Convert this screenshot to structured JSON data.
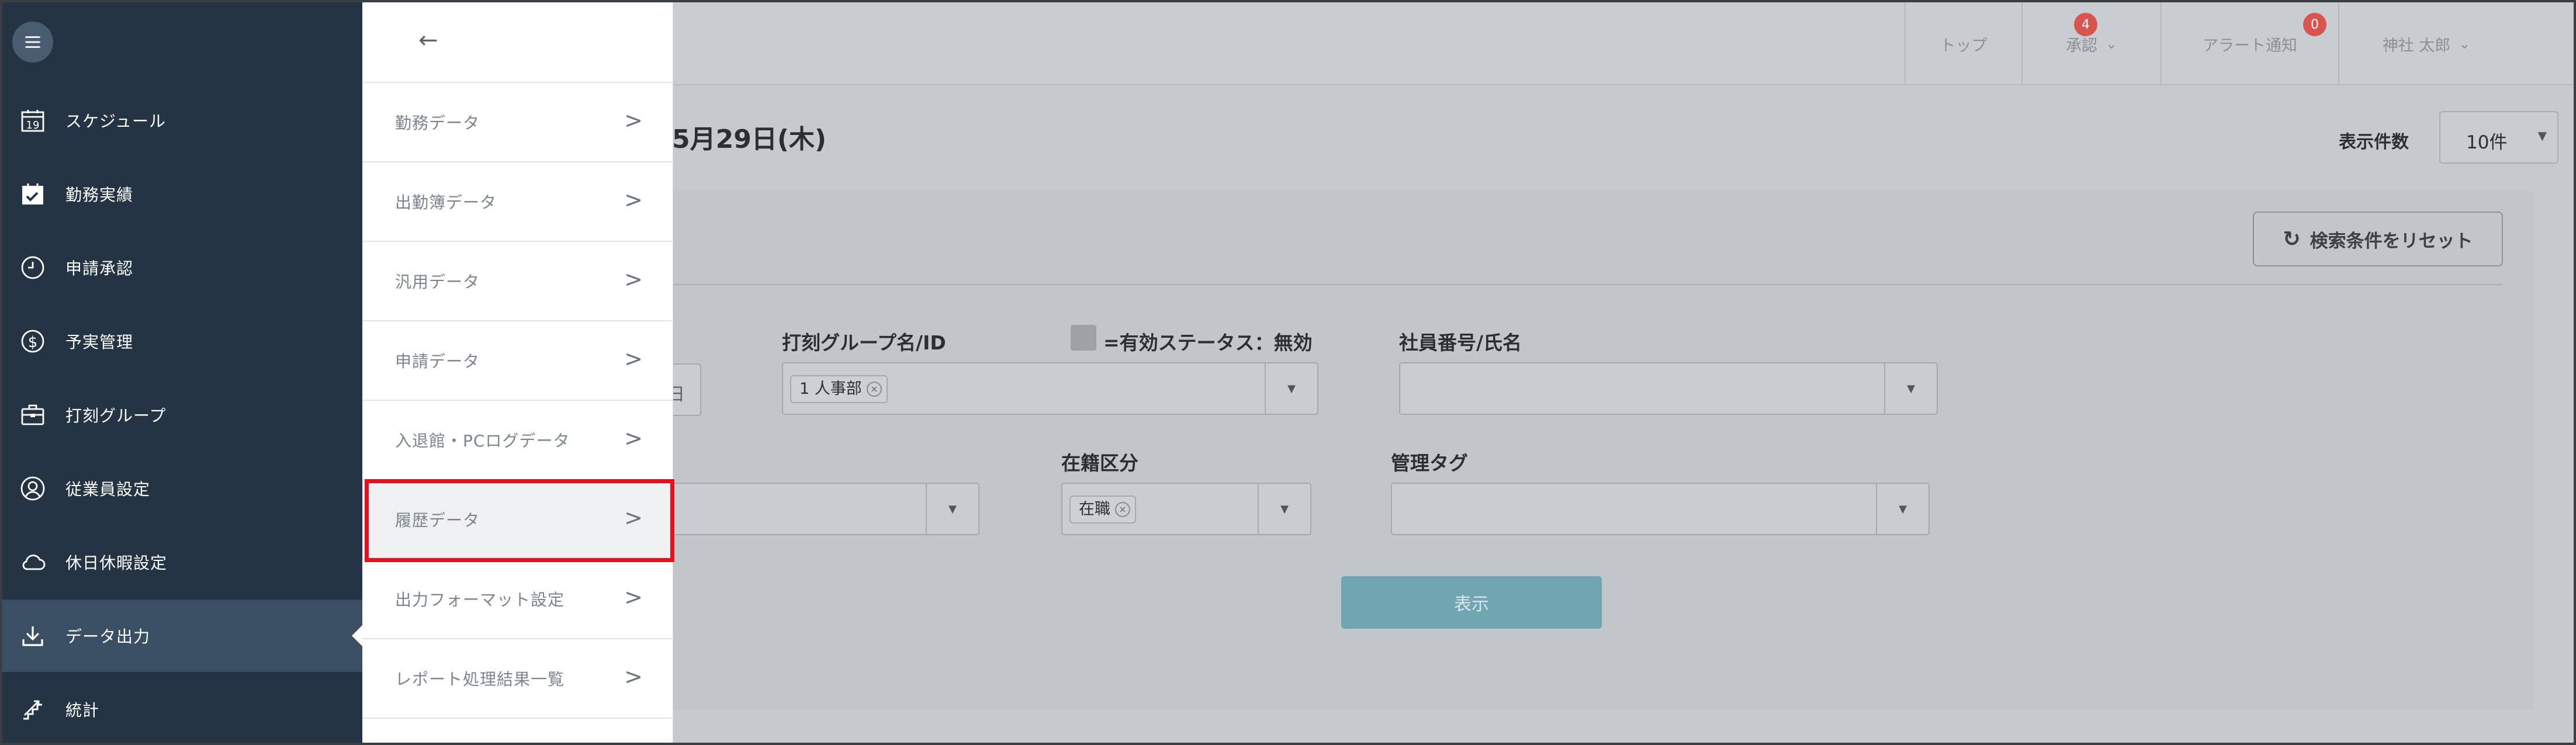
{
  "sidebar": {
    "menu_icon": "hamburger-icon",
    "items": [
      {
        "label": "スケジュール",
        "icon": "calendar-19-icon"
      },
      {
        "label": "勤務実績",
        "icon": "calendar-check-icon"
      },
      {
        "label": "申請承認",
        "icon": "clock-icon"
      },
      {
        "label": "予実管理",
        "icon": "dollar-circle-icon"
      },
      {
        "label": "打刻グループ",
        "icon": "briefcase-icon"
      },
      {
        "label": "従業員設定",
        "icon": "person-icon"
      },
      {
        "label": "休日休暇設定",
        "icon": "cloud-icon"
      },
      {
        "label": "データ出力",
        "icon": "download-icon"
      },
      {
        "label": "統計",
        "icon": "stats-stairs-icon"
      }
    ],
    "active_item": "データ出力"
  },
  "submenu": {
    "back_symbol": "←",
    "items": [
      {
        "label": "勤務データ"
      },
      {
        "label": "出勤簿データ"
      },
      {
        "label": "汎用データ"
      },
      {
        "label": "申請データ"
      },
      {
        "label": "入退館・PCログデータ"
      },
      {
        "label": "履歴データ"
      },
      {
        "label": "出力フォーマット設定"
      },
      {
        "label": "レポート処理結果一覧"
      }
    ],
    "highlighted_item": "履歴データ",
    "chevron": ">"
  },
  "header": {
    "nav": [
      {
        "label": "トップ"
      },
      {
        "label": "承認",
        "badge": "4"
      },
      {
        "label": "アラート通知",
        "badge": "0"
      },
      {
        "label": "神社 太郎"
      }
    ]
  },
  "main": {
    "title_partial": "5月29日(木)",
    "per_page_label": "表示件数",
    "per_page_value": "10件",
    "reset_button": "検索条件をリセット",
    "date_partial_char": "日",
    "fields": {
      "group_label": "打刻グループ名/ID",
      "group_chip": "1 人事部",
      "status_note": "=有効ステータス：無効",
      "employee_label": "社員番号/氏名",
      "enrollment_label": "在籍区分",
      "enrollment_chip": "在職",
      "tag_label": "管理タグ"
    },
    "show_button": "表示"
  },
  "colors": {
    "sidebar_bg": "#243444",
    "highlight_border": "#e8101c",
    "show_button": "#6fa6b2",
    "badge": "#d9534f"
  }
}
